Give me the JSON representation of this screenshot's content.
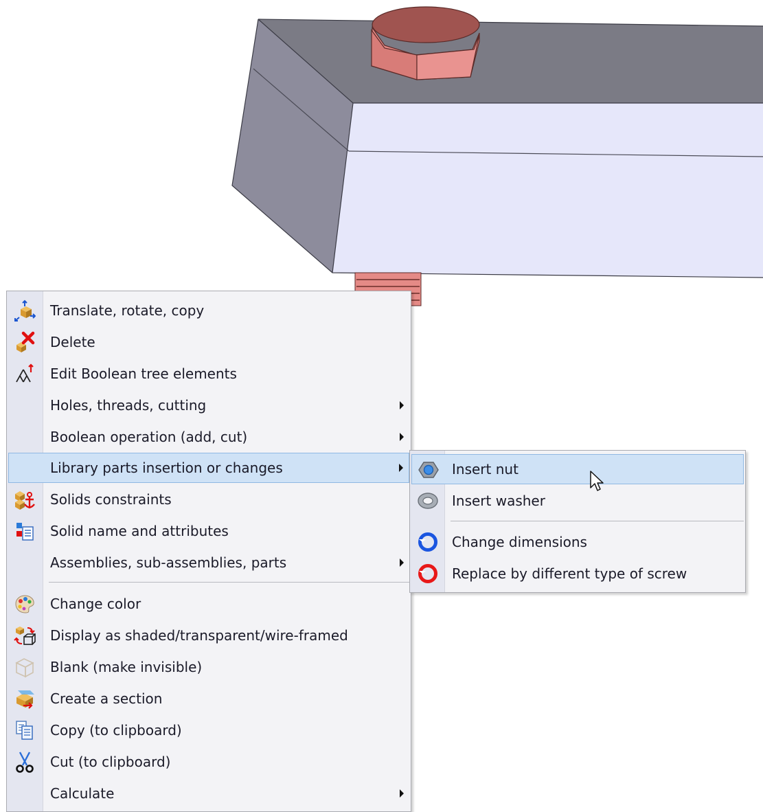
{
  "context_menu": {
    "items": [
      {
        "label": "Translate, rotate, copy",
        "icon": "translate-rotate-icon"
      },
      {
        "label": "Delete",
        "icon": "delete-icon"
      },
      {
        "label": "Edit Boolean tree elements",
        "icon": "boolean-tree-icon"
      },
      {
        "label": "Holes, threads, cutting",
        "submenu": true
      },
      {
        "label": "Boolean operation (add, cut)",
        "submenu": true
      },
      {
        "label": "Library parts insertion or changes",
        "submenu": true,
        "highlighted": true
      },
      {
        "label": "Solids constraints",
        "icon": "constraints-anchor-icon"
      },
      {
        "label": "Solid name and attributes",
        "icon": "attributes-icon"
      },
      {
        "label": "Assemblies, sub-assemblies, parts",
        "submenu": true
      },
      {
        "label": "Change color",
        "icon": "color-palette-icon"
      },
      {
        "label": "Display as shaded/transparent/wire-framed",
        "icon": "display-mode-icon"
      },
      {
        "label": "Blank (make invisible)",
        "icon": "blank-icon"
      },
      {
        "label": "Create a section",
        "icon": "section-icon"
      },
      {
        "label": "Copy (to clipboard)",
        "icon": "copy-icon"
      },
      {
        "label": "Cut (to clipboard)",
        "icon": "scissors-icon"
      },
      {
        "label": "Calculate",
        "submenu": true
      }
    ]
  },
  "submenu": {
    "items": [
      {
        "label": "Insert nut",
        "icon": "nut-icon",
        "highlighted": true
      },
      {
        "label": "Insert washer",
        "icon": "washer-icon"
      },
      {
        "label": "Change dimensions",
        "icon": "change-dimensions-icon"
      },
      {
        "label": "Replace by different type of screw",
        "icon": "replace-screw-icon"
      }
    ]
  },
  "colors": {
    "menu_bg": "#f3f3f6",
    "gutter_bg": "#e4e6f0",
    "highlight_bg": "#cfe2f6",
    "highlight_border": "#8fb8e3",
    "block_top": "#7b7b85",
    "block_front": "#e6e7fa",
    "block_side": "#8d8c9c",
    "bolt_head": "#e58a86"
  }
}
